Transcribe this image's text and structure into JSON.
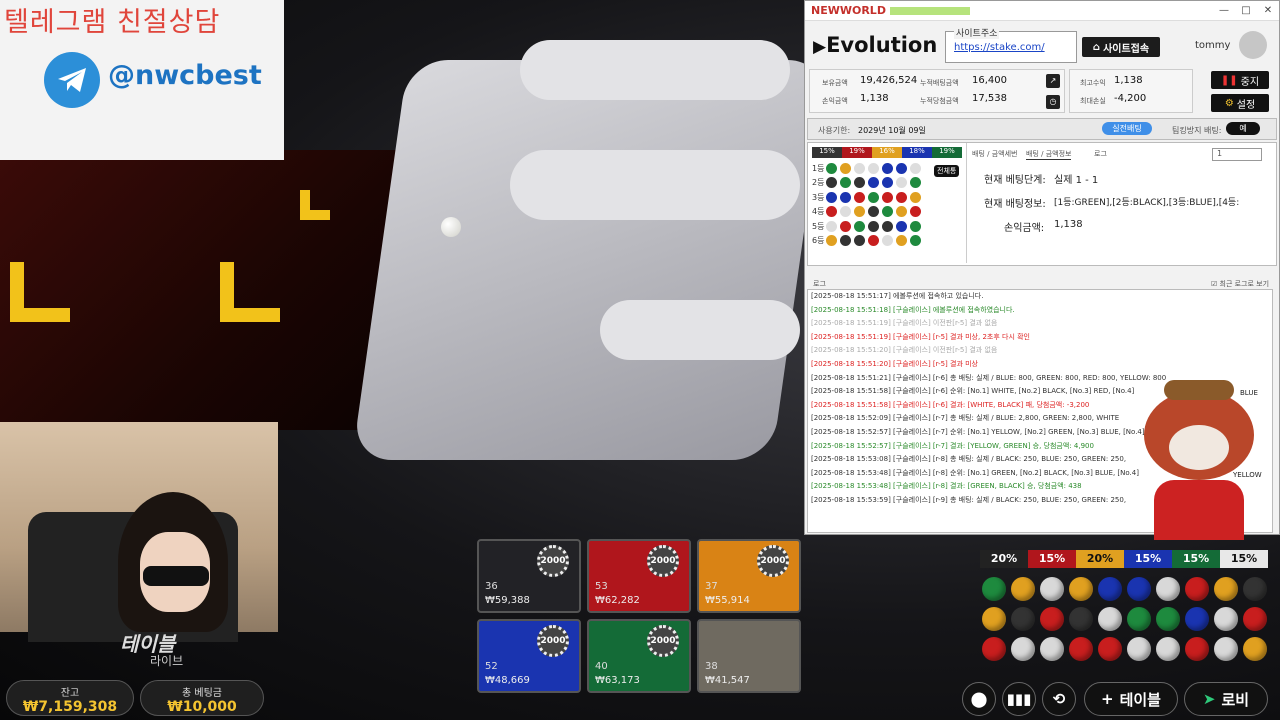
{
  "telegram": {
    "title": "텔레그램 친절상담",
    "handle": "@nwcbest"
  },
  "stream": {
    "logo": "테이블",
    "logo_sub": "라이브"
  },
  "balance": {
    "label": "잔고",
    "value": "₩7,159,308"
  },
  "total_bet": {
    "label": "총 베팅금",
    "value": "₩10,000"
  },
  "bet_tiles": [
    {
      "color": "#222226",
      "chip": "2000",
      "count": "36",
      "amount": "₩59,388"
    },
    {
      "color": "#b0161c",
      "chip": "2000",
      "count": "53",
      "amount": "₩62,282"
    },
    {
      "color": "#d98315",
      "chip": "2000",
      "count": "37",
      "amount": "₩55,914"
    },
    {
      "color": "#1a34b0",
      "chip": "2000",
      "count": "52",
      "amount": "₩48,669"
    },
    {
      "color": "#146b37",
      "chip": "2000",
      "count": "40",
      "amount": "₩63,173"
    },
    {
      "color": "#6f6a60",
      "chip": "",
      "count": "38",
      "amount": "₩41,547"
    }
  ],
  "app": {
    "brand": "NEWWORLD",
    "window_controls": [
      "—",
      "□",
      "✕"
    ],
    "provider": "Evolution",
    "site_label": "사이트주소",
    "site_url": "https://stake.com/",
    "site_button": "사이트접속",
    "user": "tommy",
    "stats": {
      "hold_label": "보유금액",
      "hold_value": "19,426,524",
      "acc_bet_label": "누적배팅금액",
      "acc_bet_value": "16,400",
      "pl_label": "손익금액",
      "pl_value": "1,138",
      "acc_win_label": "누적당첨금액",
      "acc_win_value": "17,538",
      "max_profit_label": "최고수익",
      "max_profit_value": "1,138",
      "max_loss_label": "최대손실",
      "max_loss_value": "-4,200"
    },
    "stop_button": "중지",
    "settings_button": "설정",
    "period_label": "사용기한:",
    "period_value": "2029년 10월 09일",
    "live_toggle": "실전배팅",
    "autostop_label": "팀킹방지 배팅:",
    "autostop_value": "예",
    "pct_tabs": [
      "15%",
      "19%",
      "16%",
      "18%",
      "19%"
    ],
    "grid_rows": [
      "1등",
      "2등",
      "3등",
      "4등",
      "5등",
      "6등"
    ],
    "full_view": "전체통",
    "sub_tabs": [
      "배팅 / 금액세번",
      "배팅 / 금액정보",
      "로그"
    ],
    "select_value": "1",
    "current_step_label": "현재 베팅단계:",
    "current_step_value": "실제 1 - 1",
    "current_info_label": "현재 배팅정보:",
    "current_info_value": "[1등:GREEN],[2등:BLACK],[3등:BLUE],[4등:",
    "profit_label": "손익금액:",
    "profit_value": "1,138",
    "log_title": "로그",
    "log_checkbox": "최근 로그로 보기",
    "log": [
      {
        "c": "#333",
        "t": "[2025-08-18 15:51:17] 에볼루션에 접속하고 있습니다."
      },
      {
        "c": "#2a8a2a",
        "t": "[2025-08-18 15:51:18] [구슬레이스] 에볼루션에 접속하였습니다."
      },
      {
        "c": "#aaa",
        "t": "[2025-08-18 15:51:19] [구슬레이스] 이전판[r-5] 결과 없음"
      },
      {
        "c": "#d22",
        "t": "[2025-08-18 15:51:19] [구슬레이스] [r-5] 결과 미상, 2초후 다시 확인"
      },
      {
        "c": "#aaa",
        "t": "[2025-08-18 15:51:20] [구슬레이스] 이전판[r-5] 결과 없음"
      },
      {
        "c": "#d22",
        "t": "[2025-08-18 15:51:20] [구슬레이스] [r-5] 결과 미상"
      },
      {
        "c": "#333",
        "t": "[2025-08-18 15:51:21] [구슬레이스] [r-6] 총 배팅: 실제  / BLUE: 800, GREEN: 800, RED: 800, YELLOW: 800"
      },
      {
        "c": "#333",
        "t": "[2025-08-18 15:51:58] [구슬레이스] [r-6] 순위: [No.1] WHITE, [No.2] BLACK, [No.3] RED, [No.4]"
      },
      {
        "c": "#d22",
        "t": "[2025-08-18 15:51:58] [구슬레이스] [r-6] 결과: [WHITE, BLACK] 패, 당첨금액: -3,200"
      },
      {
        "c": "#333",
        "t": "[2025-08-18 15:52:09] [구슬레이스] [r-7] 총 배팅: 실제  / BLUE: 2,800, GREEN: 2,800, WHITE"
      },
      {
        "c": "#333",
        "t": "[2025-08-18 15:52:57] [구슬레이스] [r-7] 순위: [No.1] YELLOW, [No.2] GREEN, [No.3] BLUE, [No.4]"
      },
      {
        "c": "#2a8a2a",
        "t": "[2025-08-18 15:52:57] [구슬레이스] [r-7] 결과: [YELLOW, GREEN] 승, 당첨금액: 4,900"
      },
      {
        "c": "#333",
        "t": "[2025-08-18 15:53:08] [구슬레이스] [r-8] 총 배팅: 실제  / BLACK: 250, BLUE: 250, GREEN: 250,"
      },
      {
        "c": "#333",
        "t": "[2025-08-18 15:53:48] [구슬레이스] [r-8] 순위: [No.1] GREEN, [No.2] BLACK, [No.3] BLUE, [No.4]"
      },
      {
        "c": "#2a8a2a",
        "t": "[2025-08-18 15:53:48] [구슬레이스] [r-8] 결과: [GREEN, BLACK] 승, 당첨금액: 438"
      },
      {
        "c": "#333",
        "t": "[2025-08-18 15:53:59] [구슬레이스] [r-9] 총 배팅: 실제  / BLACK: 250, BLUE: 250, GREEN: 250,"
      }
    ]
  },
  "overlay_right": [
    "BLUE",
    "YELLOW"
  ],
  "pct_bar": [
    {
      "label": "20%",
      "bg": "#222",
      "fg": "#fff"
    },
    {
      "label": "15%",
      "bg": "#b0161c",
      "fg": "#fff"
    },
    {
      "label": "20%",
      "bg": "#e0a020",
      "fg": "#111"
    },
    {
      "label": "15%",
      "bg": "#1a34b0",
      "fg": "#fff"
    },
    {
      "label": "15%",
      "bg": "#146b37",
      "fg": "#fff"
    },
    {
      "label": "15%",
      "bg": "#e8e8e8",
      "fg": "#111"
    }
  ],
  "history_dots": [
    "#1e8a3e",
    "#e0a020",
    "#d8d8d8",
    "#e0a020",
    "#1a34b0",
    "#1a34b0",
    "#d8d8d8",
    "#c81e1e",
    "#e0a020",
    "#333",
    "#e0a020",
    "#333",
    "#c81e1e",
    "#333",
    "#d8d8d8",
    "#1e8a3e",
    "#1e8a3e",
    "#1a34b0",
    "#d8d8d8",
    "#c81e1e",
    "#c81e1e",
    "#d8d8d8",
    "#d8d8d8",
    "#c81e1e",
    "#c81e1e",
    "#d8d8d8",
    "#d8d8d8",
    "#c81e1e",
    "#d8d8d8",
    "#e0a020"
  ],
  "bottom_bar": {
    "table_label": "테이블",
    "lobby_label": "로비"
  }
}
